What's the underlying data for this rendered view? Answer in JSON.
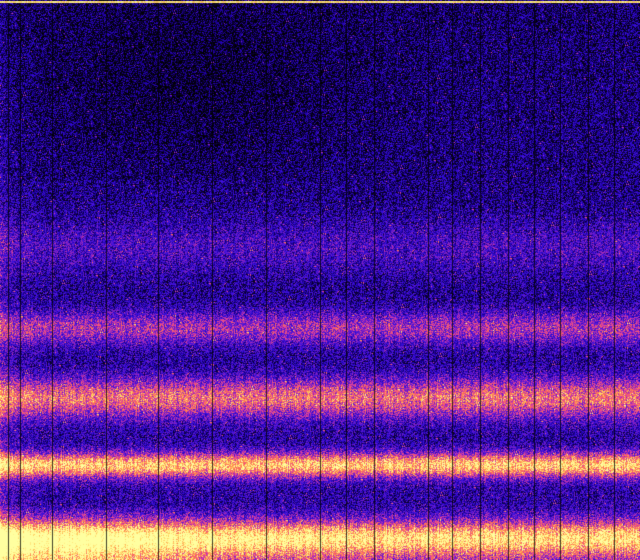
{
  "image": {
    "kind": "spectrogram-heatmap",
    "colormap": [
      "#000000",
      "#0a0030",
      "#1e00a0",
      "#3a10e0",
      "#8020c0",
      "#e040a0",
      "#ff7050",
      "#ffd060",
      "#ffffa0"
    ],
    "background": "#000000",
    "bands": [
      {
        "center": 0.83,
        "width": 0.022,
        "strength": 0.62
      },
      {
        "center": 0.71,
        "width": 0.035,
        "strength": 0.45
      },
      {
        "center": 0.585,
        "width": 0.03,
        "strength": 0.3
      },
      {
        "center": 0.44,
        "width": 0.05,
        "strength": 0.14
      },
      {
        "center": 0.96,
        "width": 0.03,
        "strength": 0.55
      }
    ],
    "top_edge_line": true,
    "vertical_stripes": true,
    "left_column_bright": true
  }
}
